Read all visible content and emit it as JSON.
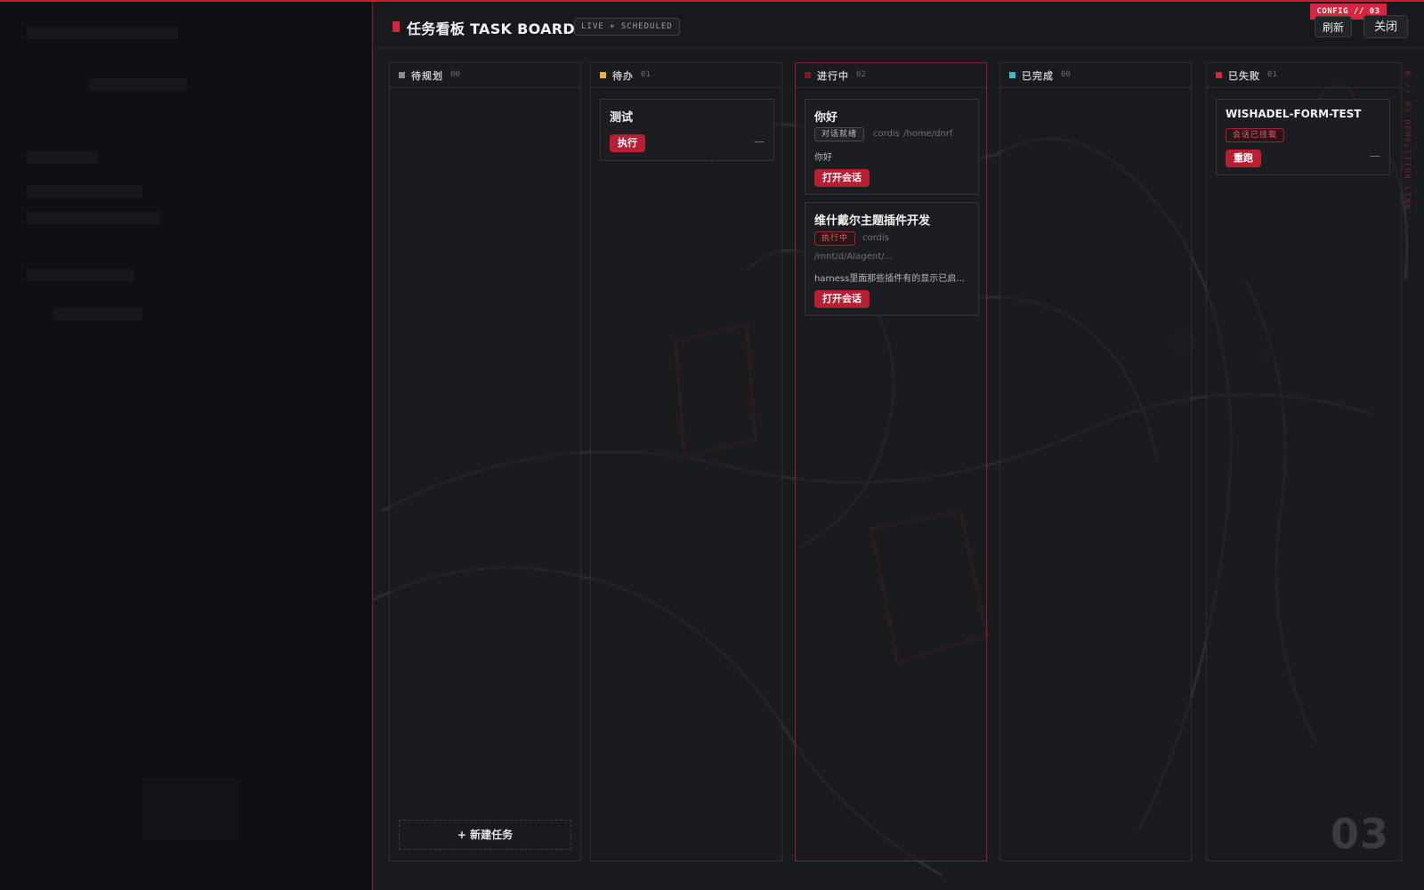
{
  "header": {
    "title": "任务看板 TASK BOARD",
    "mode_pill": "LIVE + SCHEDULED",
    "config_tag": "CONFIG // 03",
    "refresh_label": "刷新",
    "close_label": "关闭"
  },
  "decor": {
    "vertical_label": "W // 03 DEMOLITION LINK",
    "big_number": "03"
  },
  "colors": {
    "accent": "#d8253c",
    "backlog_dot": "#8a8b90",
    "todo_dot": "#e8b339",
    "in_progress_dot": "#7a1a26",
    "done_dot": "#3fb8cc",
    "failed_dot": "#d8253c"
  },
  "columns": [
    {
      "title": "待规划",
      "count": "00",
      "new_task_label": "+ 新建任务"
    },
    {
      "title": "待办",
      "count": "01"
    },
    {
      "title": "进行中",
      "count": "02"
    },
    {
      "title": "已完成",
      "count": "00"
    },
    {
      "title": "已失败",
      "count": "01"
    }
  ],
  "cards": {
    "todo_test": {
      "title": "测试",
      "action": "执行",
      "dash": "—"
    },
    "progress_hello": {
      "title": "你好",
      "tag": "对话就绪",
      "agent": "cordis",
      "path": "/home/dnrf",
      "body": "你好",
      "action": "打开会话"
    },
    "progress_plugin": {
      "title": "维什戴尔主题插件开发",
      "tag": "执行中",
      "agent": "cordis",
      "path": "/mnt/d/AIagent/...",
      "body": "harness里面那些插件有的显示已启...",
      "action": "打开会话"
    },
    "failed_form": {
      "title": "WISHADEL-FORM-TEST",
      "tag": "会话已挂载",
      "action": "重跑",
      "dash": "—"
    }
  }
}
